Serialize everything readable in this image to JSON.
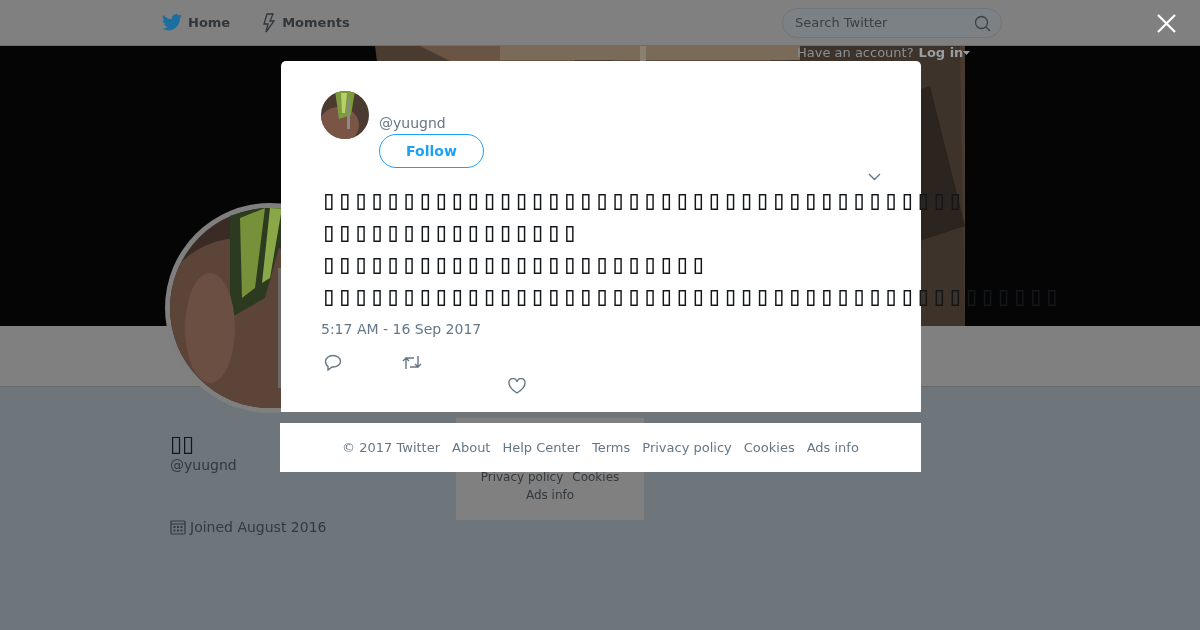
{
  "header": {
    "nav": [
      "Home",
      "Moments"
    ],
    "search": {
      "placeholder": "Search Twitter"
    },
    "login_prompt": "Have an account?",
    "login_link": "Log in"
  },
  "profile": {
    "name": "▯▯",
    "handle": "@yuugnd",
    "joined": "Joined August 2016"
  },
  "background_footer": {
    "links": [
      "Privacy policy",
      "Cookies",
      "Ads info"
    ]
  },
  "tweet": {
    "handle": "@yuugnd",
    "follow_button": "Follow",
    "text_lines": [
      "▯▯▯▯▯▯▯▯▯▯▯▯▯▯▯▯▯▯▯▯▯▯▯▯▯▯▯▯▯▯▯▯▯▯▯▯▯▯▯▯",
      "▯▯▯▯▯▯▯▯▯▯▯▯▯▯▯▯",
      "▯▯▯▯▯▯▯▯▯▯▯▯▯▯▯▯▯▯▯▯▯▯▯▯",
      "▯▯▯▯▯▯▯▯▯▯▯▯▯▯▯▯▯▯▯▯▯▯▯▯▯▯▯▯▯▯▯▯▯▯▯▯▯▯▯▯▯▯▯▯▯▯"
    ],
    "timestamp": "5:17 AM - 16 Sep 2017"
  },
  "footer": {
    "links": [
      "© 2017 Twitter",
      "About",
      "Help Center",
      "Terms",
      "Privacy policy",
      "Cookies",
      "Ads info"
    ]
  }
}
